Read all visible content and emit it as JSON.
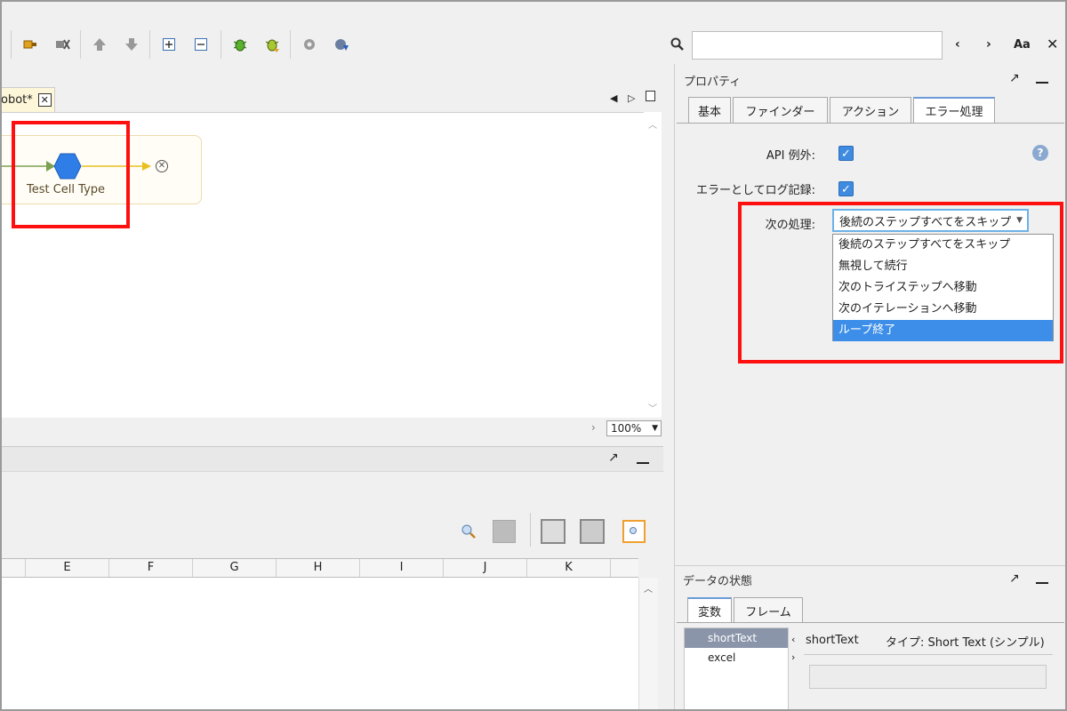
{
  "toolbar": {
    "search": {
      "value": "",
      "placeholder": ""
    },
    "case_label": "Aa",
    "icons": [
      "plug-in-icon",
      "plug-out-icon",
      "move-up-icon",
      "move-down-icon",
      "expand-icon",
      "collapse-icon",
      "debug-icon",
      "debug-step-icon",
      "settings-icon",
      "globe-icon"
    ]
  },
  "editor": {
    "tab_label": "obot*",
    "node_label": "Test Cell Type",
    "zoom": "100%"
  },
  "grid": {
    "columns": [
      "",
      "E",
      "F",
      "G",
      "H",
      "I",
      "J",
      "K"
    ]
  },
  "properties": {
    "title": "プロパティ",
    "tabs": [
      "基本",
      "ファインダー",
      "アクション",
      "エラー処理"
    ],
    "active_tab": "エラー処理",
    "api_exception_label": "API 例外:",
    "log_error_label": "エラーとしてログ記録:",
    "next_action_label": "次の処理:",
    "next_action_value": "後続のステップすべてをスキップ",
    "options": [
      "後続のステップすべてをスキップ",
      "無視して続行",
      "次のトライステップへ移動",
      "次のイテレーションへ移動",
      "ループ終了"
    ]
  },
  "data_state": {
    "title": "データの状態",
    "tabs": [
      "変数",
      "フレーム"
    ],
    "variables": [
      "shortText",
      "excel"
    ],
    "selected_name": "shortText",
    "selected_type": "タイプ: Short Text (シンプル)"
  },
  "colors": {
    "highlight_red": "#ff1010",
    "selection_blue": "#3d8ee8",
    "checkbox_blue": "#3e8be0"
  }
}
